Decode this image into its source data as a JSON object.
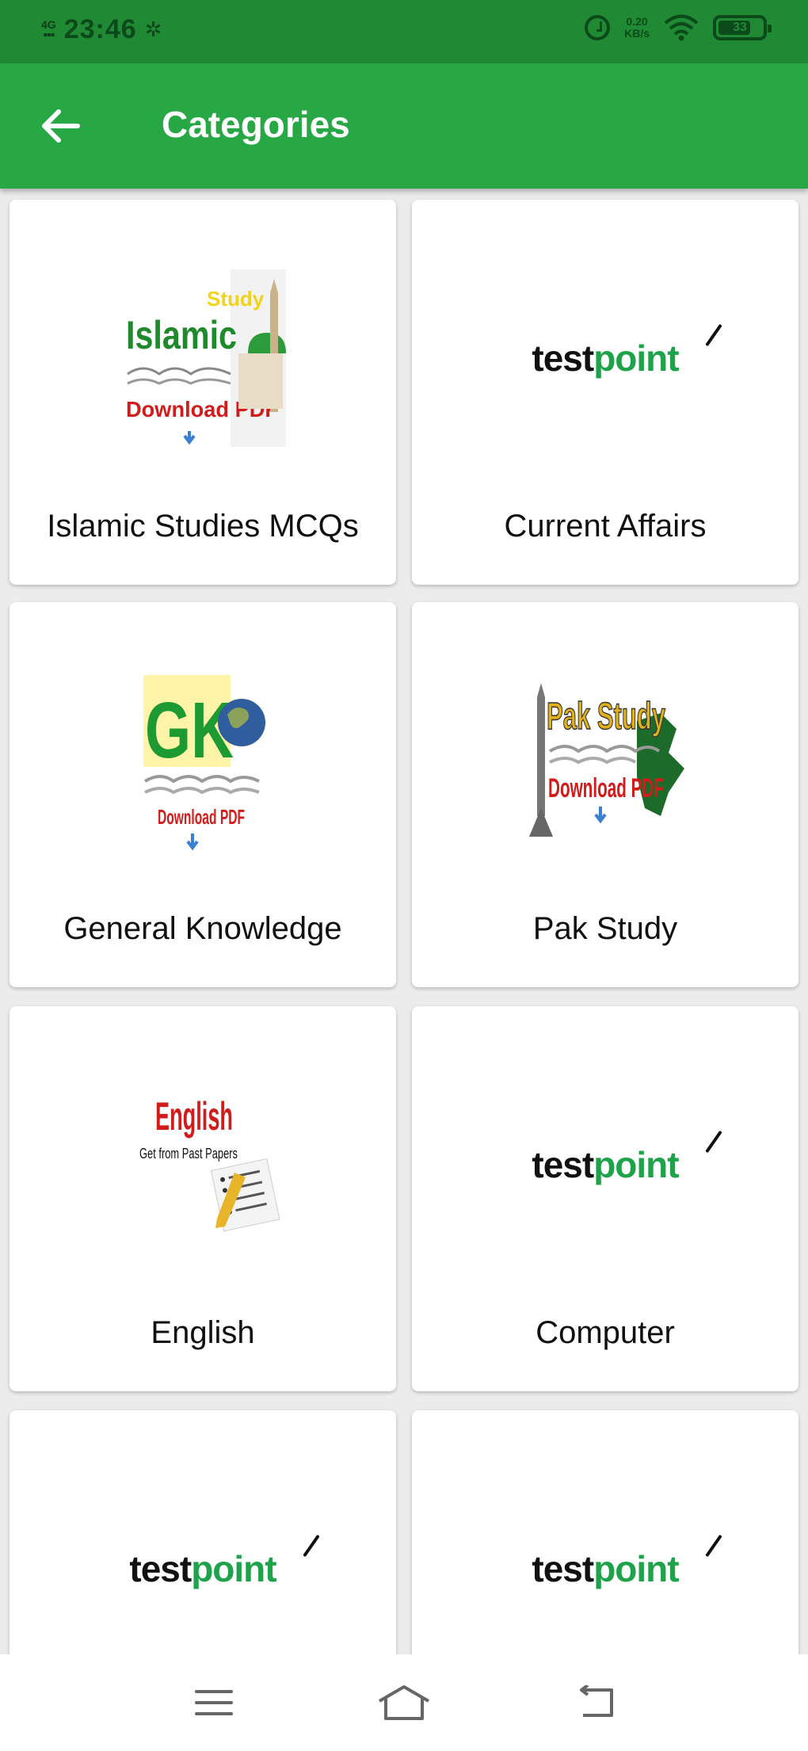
{
  "status_bar": {
    "network": "4G",
    "time": "23:46",
    "speed_value": "0.20",
    "speed_unit": "KB/s",
    "battery": "33"
  },
  "header": {
    "title": "Categories"
  },
  "categories": [
    {
      "label": "Islamic Studies MCQs",
      "image": "islamic-study-thumb"
    },
    {
      "label": "Current Affairs",
      "image": "testpoint-logo"
    },
    {
      "label": "General Knowledge",
      "image": "gk-thumb"
    },
    {
      "label": "Pak Study",
      "image": "pak-study-thumb"
    },
    {
      "label": "English",
      "image": "english-thumb"
    },
    {
      "label": "Computer",
      "image": "testpoint-logo"
    },
    {
      "label": "",
      "image": "testpoint-logo"
    },
    {
      "label": "",
      "image": "testpoint-logo"
    }
  ],
  "logo_text": {
    "test": "test",
    "point": "point"
  },
  "thumbs": {
    "islamic": {
      "study": "Study",
      "title": "Islamic",
      "download": "Download PDF"
    },
    "gk": {
      "title": "GK",
      "download": "Download PDF"
    },
    "pak": {
      "title": "Pak Study",
      "download": "Download PDF"
    },
    "english": {
      "title": "English",
      "sub": "Get from Past Papers"
    }
  },
  "colors": {
    "app_bar": "#28a745",
    "status_bar": "#1f8a33",
    "logo_green": "#1fa34a"
  },
  "bottom_nav": [
    "menu-icon",
    "home-icon",
    "back-icon"
  ]
}
